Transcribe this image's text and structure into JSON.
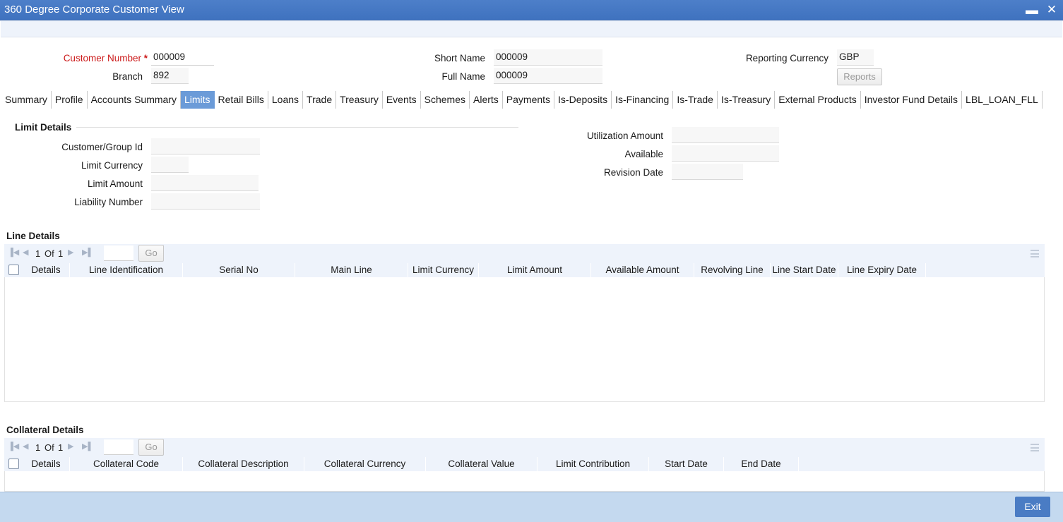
{
  "window": {
    "title": "360 Degree Corporate Customer View",
    "minimize_glyph": "▬",
    "close_glyph": "✕"
  },
  "header": {
    "customer_number_label": "Customer Number",
    "customer_number_required": "*",
    "customer_number": "000009",
    "branch_label": "Branch",
    "branch": "892",
    "short_name_label": "Short Name",
    "short_name": "000009",
    "full_name_label": "Full Name",
    "full_name": "000009",
    "reporting_currency_label": "Reporting Currency",
    "reporting_currency": "GBP",
    "reports_button": "Reports"
  },
  "tabs": [
    "Summary",
    "Profile",
    "Accounts Summary",
    "Limits",
    "Retail Bills",
    "Loans",
    "Trade",
    "Treasury",
    "Events",
    "Schemes",
    "Alerts",
    "Payments",
    "Is-Deposits",
    "Is-Financing",
    "Is-Trade",
    "Is-Treasury",
    "External Products",
    "Investor Fund Details",
    "LBL_LOAN_FLL"
  ],
  "active_tab": "Limits",
  "limit_details": {
    "heading": "Limit Details",
    "customer_group_id_label": "Customer/Group Id",
    "customer_group_id": "",
    "limit_currency_label": "Limit Currency",
    "limit_currency": "",
    "limit_amount_label": "Limit Amount",
    "limit_amount": "",
    "liability_number_label": "Liability Number",
    "liability_number": "",
    "utilization_amount_label": "Utilization Amount",
    "utilization_amount": "",
    "available_label": "Available",
    "available": "",
    "revision_date_label": "Revision Date",
    "revision_date": ""
  },
  "line_details": {
    "heading": "Line Details",
    "page_current": "1",
    "page_of": "Of",
    "page_total": "1",
    "go_label": "Go",
    "columns": [
      "Details",
      "Line Identification",
      "Serial No",
      "Main Line",
      "Limit Currency",
      "Limit Amount",
      "Available Amount",
      "Revolving Line",
      "Line Start Date",
      "Line Expiry Date"
    ]
  },
  "collateral_details": {
    "heading": "Collateral Details",
    "page_current": "1",
    "page_of": "Of",
    "page_total": "1",
    "go_label": "Go",
    "columns": [
      "Details",
      "Collateral Code",
      "Collateral Description",
      "Collateral Currency",
      "Collateral Value",
      "Limit Contribution",
      "Start Date",
      "End Date"
    ]
  },
  "footer": {
    "exit_button": "Exit"
  },
  "colors": {
    "titlebar": "#4279c4",
    "active_tab": "#6b9bd8",
    "footer": "#c4d9ef",
    "required": "#cc1a1a"
  }
}
